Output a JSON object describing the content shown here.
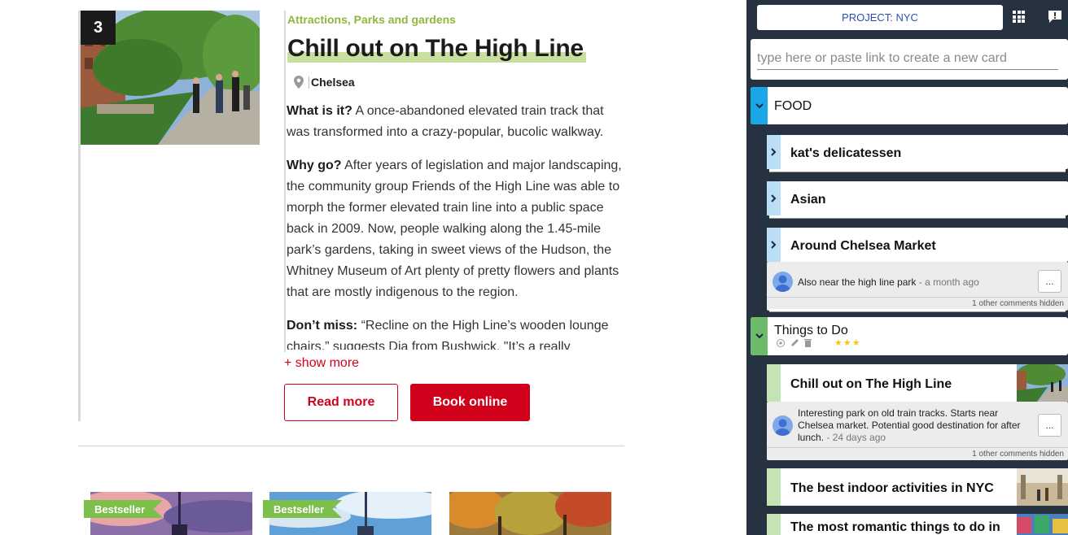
{
  "article": {
    "rank": "3",
    "category": "Attractions, Parks and gardens",
    "title": "Chill out on The High Line",
    "location": "Chelsea",
    "paragraphs": [
      {
        "lead": "What is it?",
        "text": " A once-abandoned elevated train track that was transformed into a crazy-popular, bucolic walkway."
      },
      {
        "lead": "Why go?",
        "text": " After years of legislation and major landscaping, the community group Friends of the High Line was able to morph the former elevated train line into a public space back in 2009. Now, people walking along the 1.45-mile park’s gardens, taking in sweet views of the Hudson, the Whitney Museum of Art plenty of pretty flowers and plants that are mostly indigenous to the region."
      },
      {
        "lead": "Don’t miss:",
        "text": " “Recline on the High Line’s wooden lounge chairs,” suggests Dia from Bushwick. \"It’s a really"
      }
    ],
    "show_more": "+ show more",
    "read_more": "Read more",
    "book_online": "Book online",
    "tags": [
      "Bestseller",
      "Bestseller"
    ]
  },
  "sidebar": {
    "project_label": "PROJECT: NYC",
    "new_card_placeholder": "type here or paste link to create a new card",
    "groups": [
      {
        "title": "FOOD",
        "color": "#1aa7e8"
      },
      {
        "title": "Things to Do",
        "color": "#6dbb6a",
        "stars": "★★★"
      }
    ],
    "food_cards": [
      {
        "title": "kat's delicatessen"
      },
      {
        "title": "Asian"
      },
      {
        "title": "Around Chelsea Market"
      }
    ],
    "food_comment": {
      "text": "Also near the high line park",
      "ago": " - a month ago",
      "menu": "...",
      "hidden": "1 other comments hidden"
    },
    "todo_cards": [
      {
        "title": "Chill out on The High Line"
      },
      {
        "title": "The best indoor activities in NYC"
      },
      {
        "title": "The most romantic things to do in"
      }
    ],
    "todo_comment": {
      "text": "Interesting park on old train tracks. Starts near Chelsea market. Potential good destination for after lunch.",
      "ago": " - 24 days ago",
      "menu": "...",
      "hidden": "1 other comments hidden"
    }
  }
}
